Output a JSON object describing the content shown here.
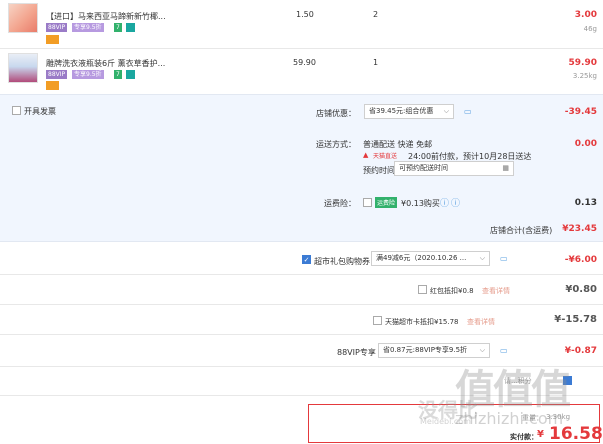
{
  "items": [
    {
      "name": "【进口】马来西亚马蹄新新竹椰...",
      "price": "1.50",
      "qty": "2",
      "subtotal": "3.00",
      "weight": "46g",
      "vip_badge": "88VIP",
      "vip_discount": "专享9.5折",
      "seven_day": "7"
    },
    {
      "name": "雕牌洗衣液瓶装6斤 薰衣草香护...",
      "price": "59.90",
      "qty": "1",
      "subtotal": "59.90",
      "weight": "3.25kg",
      "vip_badge": "88VIP",
      "vip_discount": "专享9.5折",
      "seven_day": "7"
    }
  ],
  "store": {
    "invoice_label": "开具发票",
    "discount_label": "店铺优惠：",
    "discount_select": "省39.45元:组合优惠",
    "discount_value": "-39.45",
    "shipping_label": "运送方式：",
    "shipping_method": "普通配送 快递 免邮",
    "tmall_logo": "天猫直送",
    "shipping_note": "24:00前付款，预计10月28日送达",
    "delivery_label": "预约时间",
    "delivery_placeholder": "可预约配送时间",
    "shipping_value": "0.00",
    "insurance_label": "运费险：",
    "insurance_badge": "运费险",
    "insurance_desc": "¥0.13购买",
    "insurance_value": "0.13",
    "store_total_label": "店铺合计(含运费)",
    "store_total_value": "¥23.45"
  },
  "coupons": [
    {
      "label": "超市礼包购物券",
      "select": "满49减6元（2020.10.26 ...",
      "value": "-¥6.00",
      "checked": true
    },
    {
      "label": "红包抵扣¥0.8",
      "link": "查看详情",
      "value": "¥0.80",
      "checked": false
    },
    {
      "label": "天猫超市卡抵扣¥15.78",
      "link": "查看详情",
      "value": "¥-15.78",
      "checked": false
    }
  ],
  "vip": {
    "label": "88VIP专享",
    "select": "省0.87元:88VIP专享9.5折",
    "value": "¥-0.87"
  },
  "bottom": {
    "partial_text": "请...积分",
    "watermark_main": "值值值",
    "watermark_sub": "zhizhizhi.com",
    "watermark_left": "没得比",
    "watermark_left_sub": "Meidebi.com",
    "weight_label": "重量：",
    "weight_value": "3.30kg",
    "paid_label": "实付款：",
    "paid_symbol": "¥",
    "paid_value": "16.58"
  },
  "colors": {
    "accent": "#e4393c",
    "section_bg": "#f1f6fe",
    "vip_purple": "#9a7bc7",
    "green": "#32b16c"
  }
}
